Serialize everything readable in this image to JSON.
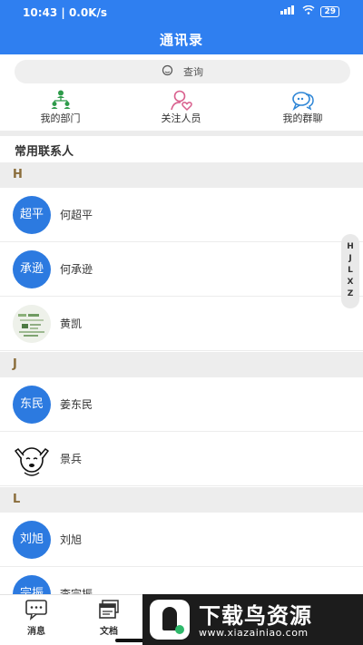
{
  "status": {
    "time": "10:43",
    "speed": "0.0K/s",
    "signal": "HD",
    "battery": "29"
  },
  "header": {
    "title": "通讯录"
  },
  "search": {
    "placeholder": "查询"
  },
  "quick": [
    {
      "label": "我的部门",
      "icon": "org-chart-icon",
      "color": "#2e9b4a"
    },
    {
      "label": "关注人员",
      "icon": "person-heart-icon",
      "color": "#d9608e"
    },
    {
      "label": "我的群聊",
      "icon": "group-chat-icon",
      "color": "#2f86d6"
    }
  ],
  "common_title": "常用联系人",
  "sections": {
    "h": {
      "letter": "H"
    },
    "j": {
      "letter": "J"
    },
    "l": {
      "letter": "L"
    }
  },
  "contacts": [
    {
      "avatar_text": "超平",
      "name": "何超平"
    },
    {
      "avatar_text": "承逊",
      "name": "何承逊"
    },
    {
      "avatar_text": "",
      "name": "黄凯",
      "avatar_icon": "photo-avatar"
    },
    {
      "avatar_text": "东民",
      "name": "姜东民"
    },
    {
      "avatar_text": "",
      "name": "景兵",
      "avatar_icon": "cartoon-avatar"
    },
    {
      "avatar_text": "刘旭",
      "name": "刘旭"
    },
    {
      "avatar_text": "宗振",
      "name": "李宗振"
    }
  ],
  "index_bar": {
    "letters": [
      "H",
      "J",
      "L",
      "X",
      "Z"
    ]
  },
  "tabs": [
    {
      "label": "消息",
      "icon": "message-icon"
    },
    {
      "label": "文档",
      "icon": "document-icon"
    }
  ],
  "watermark": {
    "brand": "下载鸟资源",
    "url": "www.xiazainiao.com"
  },
  "colors": {
    "accent": "#2f7ff0",
    "avatar_blue": "#2c7ae0",
    "section_letter": "#8a6d3b"
  }
}
